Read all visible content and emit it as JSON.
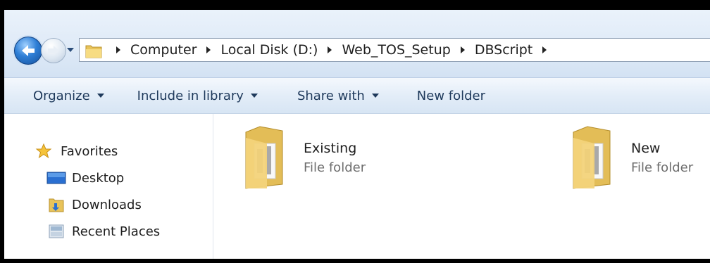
{
  "address_bar": {
    "breadcrumbs": [
      "Computer",
      "Local Disk (D:)",
      "Web_TOS_Setup",
      "DBScript"
    ]
  },
  "toolbar": {
    "organize_label": "Organize",
    "include_label": "Include in library",
    "share_label": "Share with",
    "new_folder_label": "New folder"
  },
  "navigation": {
    "favorites_label": "Favorites",
    "items": [
      {
        "label": "Desktop",
        "icon": "desktop-icon"
      },
      {
        "label": "Downloads",
        "icon": "downloads-folder-icon"
      },
      {
        "label": "Recent Places",
        "icon": "recent-places-icon"
      }
    ]
  },
  "content": {
    "items": [
      {
        "name": "Existing",
        "type": "File folder",
        "icon": "folder-icon"
      },
      {
        "name": "New",
        "type": "File folder",
        "icon": "folder-icon"
      }
    ]
  }
}
